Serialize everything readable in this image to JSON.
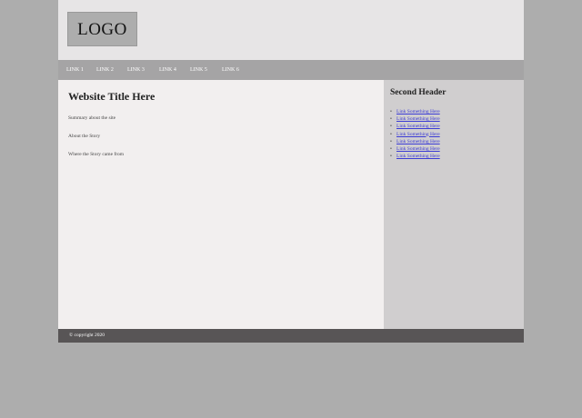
{
  "header": {
    "logo_text": "LOGO"
  },
  "nav": {
    "links": [
      "LINK 1",
      "LINK 2",
      "LINK 3",
      "LINK 4",
      "LINK 5",
      "LINK 6"
    ]
  },
  "main": {
    "title": "Website Title Here",
    "paragraphs": [
      "Summary about the site",
      "About the Story",
      "Where the Story came from"
    ]
  },
  "sidebar": {
    "heading": "Second Header",
    "links": [
      "Link Something Here",
      "Link Something Here",
      "Link Something Here",
      "Link Something Here",
      "Link Something Here",
      "Link Something Here",
      "Link Something Here"
    ]
  },
  "footer": {
    "copyright": "© copyright 2020"
  },
  "colors": {
    "background": "#adadad",
    "header_bg": "#e7e5e6",
    "nav_bg": "#a5a4a5",
    "main_bg": "#f2efef",
    "sidebar_bg": "#d0cecf",
    "footer_bg": "#585556",
    "link_color": "#3b3bd6"
  }
}
